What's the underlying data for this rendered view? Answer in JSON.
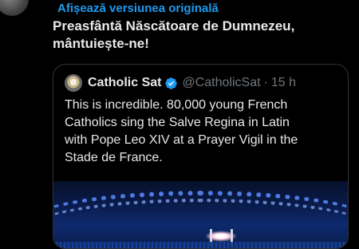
{
  "post": {
    "translate_link": "Afișează versiunea originală",
    "text_lines": [
      "Preasfântă Născătoare de Dumnezeu,",
      "mântuiește-ne!"
    ]
  },
  "quote": {
    "display_name": "Catholic Sat",
    "handle": "@CatholicSat",
    "separator": "·",
    "time": "15 h",
    "text_lines": [
      "This is incredible. 80,000 young French",
      "Catholics sing the Salve Regina in Latin",
      "with Pope Leo XIV at a Prayer Vigil in the",
      "Stade de France."
    ],
    "media": {
      "icon": "stadium-photo"
    }
  },
  "colors": {
    "background": "#000000",
    "text": "#e7e9ea",
    "link": "#1d9bf0",
    "muted": "#71767b",
    "border": "#2f3336",
    "verified": "#1d9bf0"
  }
}
